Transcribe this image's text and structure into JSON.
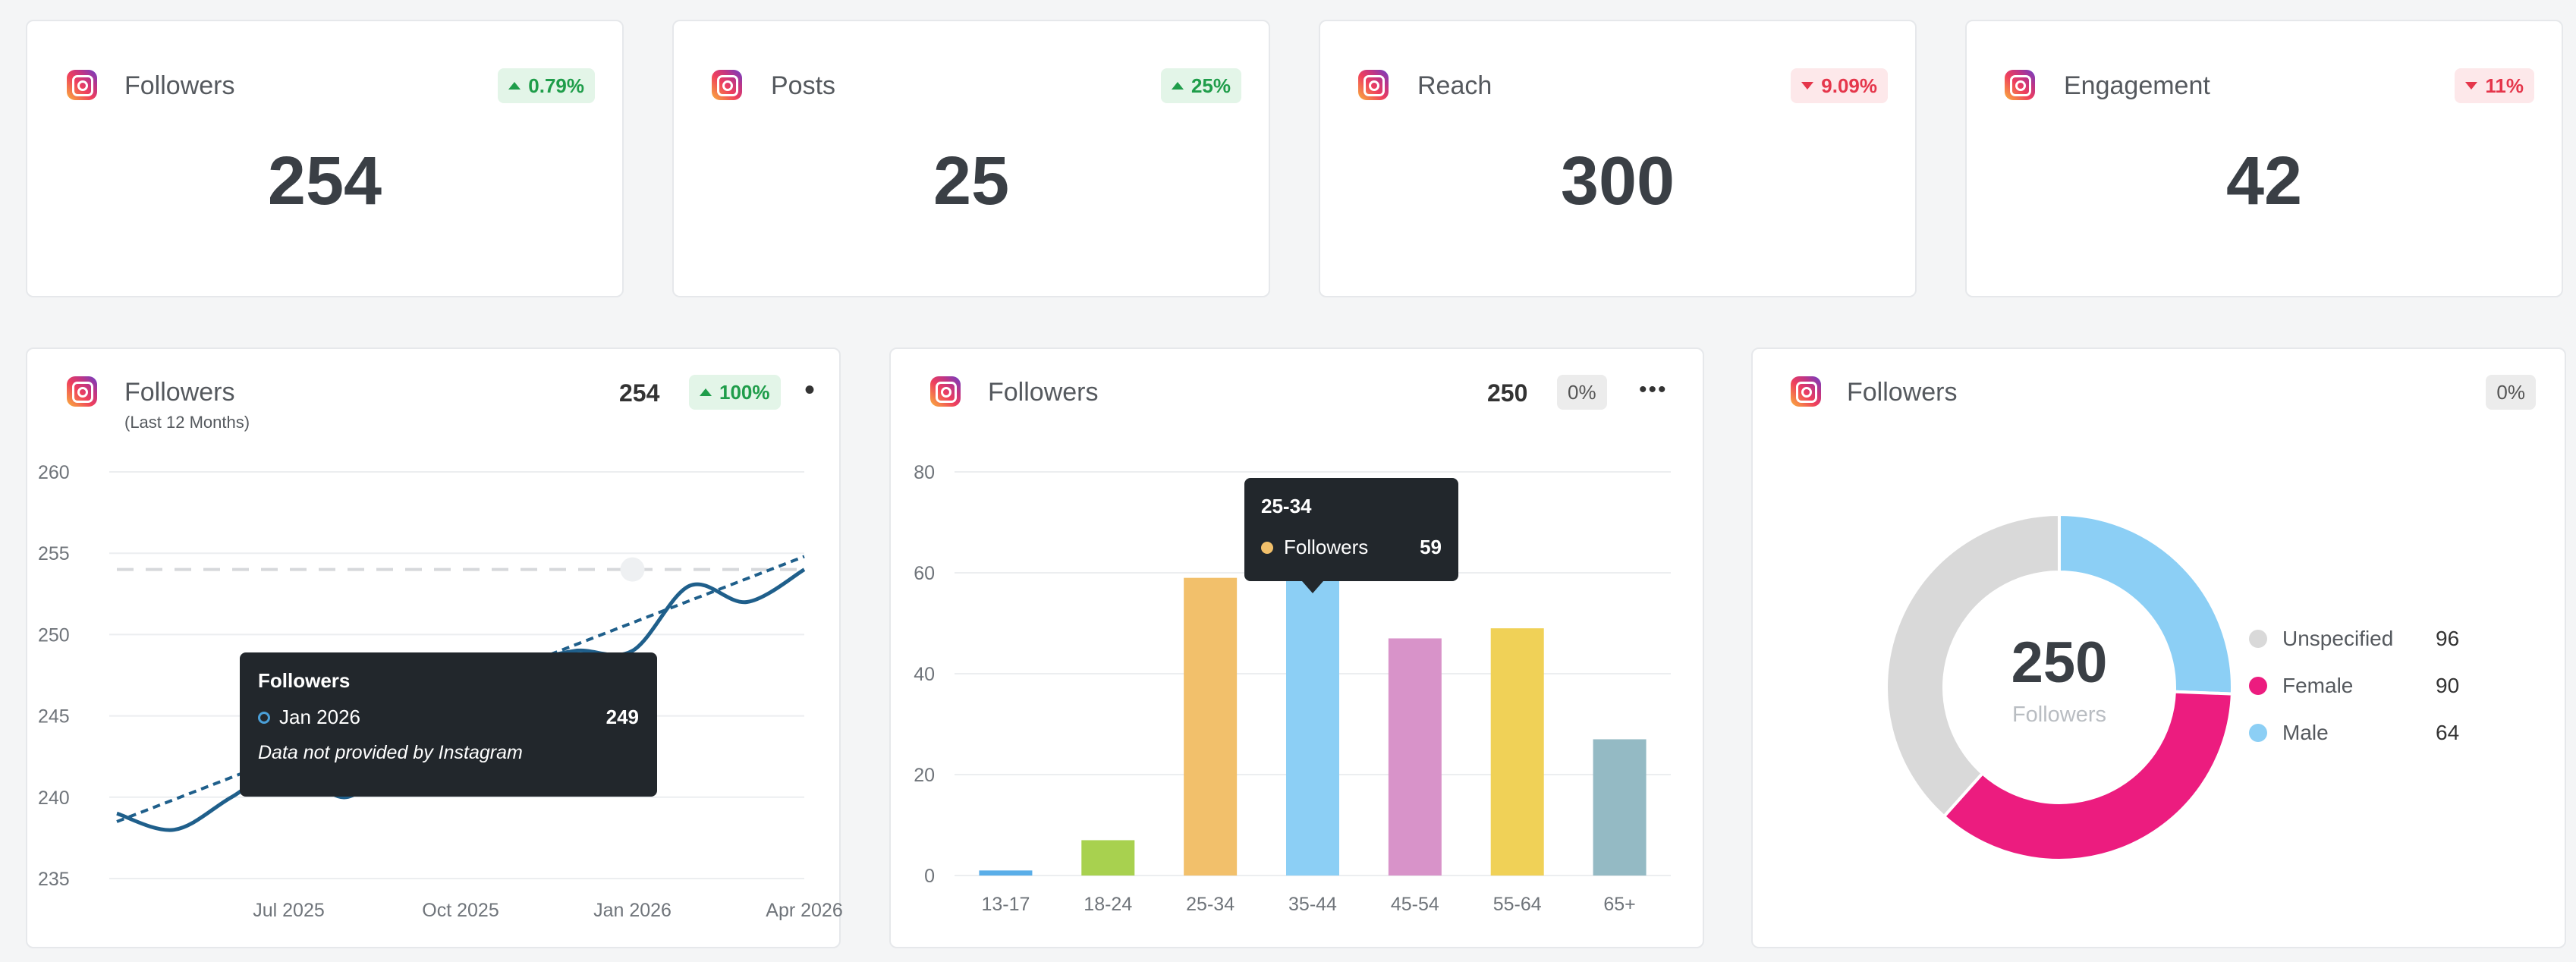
{
  "kpis": [
    {
      "title": "Followers",
      "change": "0.79%",
      "direction": "up",
      "value": "254"
    },
    {
      "title": "Posts",
      "change": "25%",
      "direction": "up",
      "value": "25"
    },
    {
      "title": "Reach",
      "change": "9.09%",
      "direction": "down",
      "value": "300"
    },
    {
      "title": "Engagement",
      "change": "11%",
      "direction": "down",
      "value": "42"
    }
  ],
  "line_card": {
    "title": "Followers",
    "subtitle": "(Last 12 Months)",
    "value": "254",
    "change": "100%",
    "tooltip": {
      "title": "Followers",
      "label": "Jan 2026",
      "value": "249",
      "note": "Data not provided by Instagram"
    }
  },
  "bar_card": {
    "title": "Followers",
    "value": "250",
    "change": "0%",
    "menu": "•••",
    "tooltip": {
      "title": "25-34",
      "label": "Followers",
      "value": "59"
    }
  },
  "donut_card": {
    "title": "Followers",
    "change": "0%",
    "center_value": "250",
    "center_label": "Followers"
  },
  "chart_data": [
    {
      "type": "line",
      "ylim": [
        235,
        260
      ],
      "yticks": [
        235,
        240,
        245,
        250,
        255,
        260
      ],
      "xticks": [
        "Jul 2025",
        "Oct 2025",
        "Jan 2026",
        "Apr 2026"
      ],
      "x": [
        "Apr 2025",
        "May 2025",
        "Jun 2025",
        "Jul 2025",
        "Aug 2025",
        "Sep 2025",
        "Oct 2025",
        "Nov 2025",
        "Dec 2025",
        "Jan 2026",
        "Feb 2026",
        "Mar 2026",
        "Apr 2026"
      ],
      "series": [
        {
          "name": "Followers",
          "values": [
            239,
            238,
            240,
            242,
            240,
            243,
            246,
            248,
            249,
            249,
            253,
            252,
            254
          ],
          "color": "#1f5f8b"
        }
      ],
      "trend": [
        238.5,
        254.8
      ],
      "reference_line": 254
    },
    {
      "type": "bar",
      "categories": [
        "13-17",
        "18-24",
        "25-34",
        "35-44",
        "45-54",
        "55-64",
        "65+"
      ],
      "values": [
        1,
        7,
        59,
        59,
        47,
        49,
        27
      ],
      "colors": [
        "#5aaee8",
        "#a8d14f",
        "#f2c06b",
        "#8ccff5",
        "#d893c9",
        "#f0d157",
        "#94bac4"
      ],
      "ylim": [
        0,
        80
      ],
      "yticks": [
        0,
        20,
        40,
        60,
        80
      ]
    },
    {
      "type": "pie",
      "labels": [
        "Unspecified",
        "Female",
        "Male"
      ],
      "values": [
        96,
        90,
        64
      ],
      "colors": [
        "#d9d9d9",
        "#ec1c7f",
        "#8ccff5"
      ]
    }
  ]
}
